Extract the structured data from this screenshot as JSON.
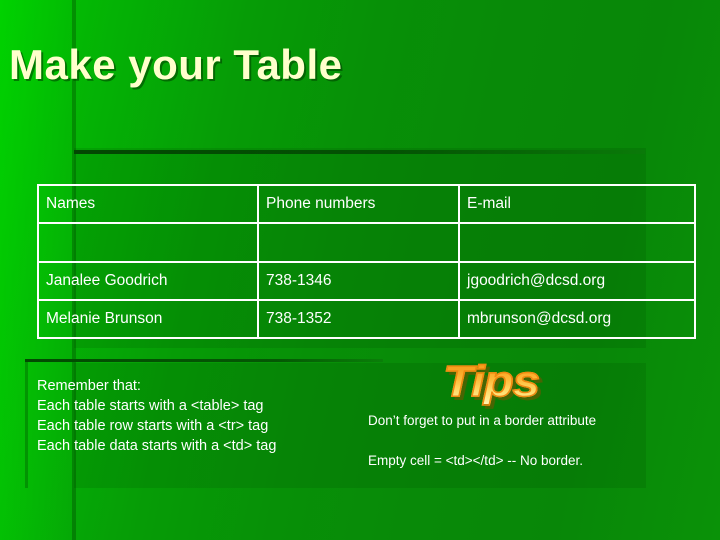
{
  "slide": {
    "title": "Make your Table",
    "background": {
      "gradient_from": "#00c800",
      "gradient_to": "#088808"
    },
    "title_color": "#ffffcc"
  },
  "table": {
    "border_color": "#ffffff",
    "text_color": "#ffffff",
    "headers": [
      "Names",
      "Phone numbers",
      "E-mail"
    ],
    "rows": [
      [
        "",
        "",
        ""
      ],
      [
        "Janalee Goodrich",
        "738-1346",
        "jgoodrich@dcsd.org"
      ],
      [
        "Melanie Brunson",
        "738-1352",
        "mbrunson@dcsd.org"
      ]
    ]
  },
  "notes": {
    "left": [
      "Remember that:",
      "Each table starts with a <table> tag",
      "Each table row starts with a <tr> tag",
      "Each table data starts with a <td> tag"
    ],
    "tips_heading": "Tips",
    "tips_colors": {
      "fill_top": "#f59a18",
      "fill_bottom": "#fff4b0",
      "outline": "#f08a10"
    },
    "right": [
      "Don’t forget to put in a border attribute",
      "Empty cell = <td></td> -- No border."
    ]
  }
}
